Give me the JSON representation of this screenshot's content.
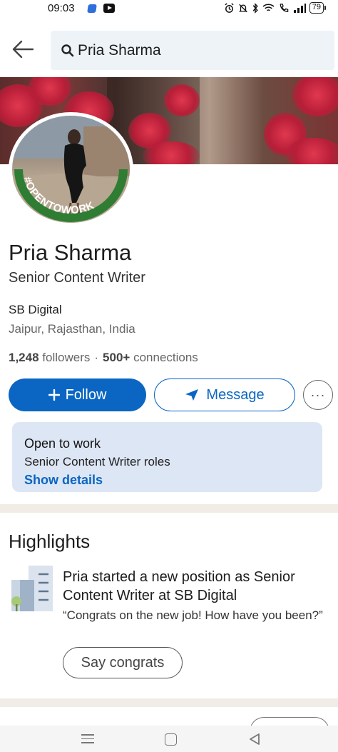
{
  "status_bar": {
    "time": "09:03",
    "battery": "79"
  },
  "search": {
    "query": "Pria Sharma"
  },
  "profile": {
    "badge": "#OPENTOWORK",
    "name": "Pria Sharma",
    "headline": "Senior Content Writer",
    "company": "SB Digital",
    "location": "Jaipur, Rajasthan, India",
    "followers_count": "1,248",
    "followers_label": "followers",
    "separator": "·",
    "connections_count": "500+",
    "connections_label": "connections"
  },
  "actions": {
    "follow_label": "Follow",
    "message_label": "Message",
    "more_label": "···"
  },
  "open_to_work": {
    "title": "Open to work",
    "roles": "Senior Content Writer roles",
    "link": "Show details"
  },
  "highlights": {
    "title": "Highlights",
    "headline": "Pria started a new position as Senior Content Writer at SB Digital",
    "quote": "“Congrats on the new job! How have you been?”",
    "button": "Say congrats"
  },
  "colors": {
    "brand": "#0a66c2",
    "open_to_work_green": "#2e7d32",
    "card_bg": "#dde6f4"
  },
  "icons": {
    "back": "arrow-left-icon",
    "search": "search-icon",
    "follow": "plus-icon",
    "message": "paper-plane-icon",
    "more": "ellipsis-icon",
    "highlight": "building-icon"
  }
}
